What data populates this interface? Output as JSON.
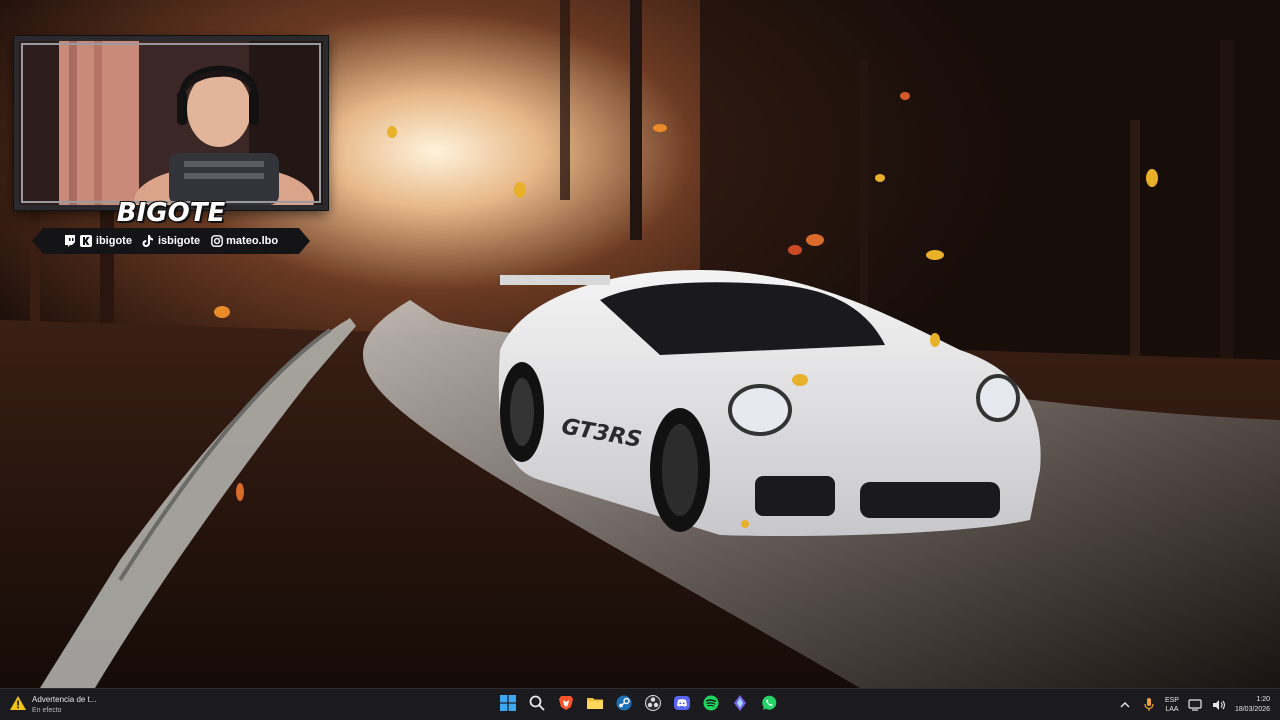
{
  "webcam": {
    "brand": "BIGOTE",
    "socials": [
      {
        "icon": "twitch-icon",
        "handle": "ibigote"
      },
      {
        "icon": "tiktok-icon",
        "handle": "isbigote"
      },
      {
        "icon": "instagram-icon",
        "handle": "mateo.lbo"
      }
    ]
  },
  "taskbar": {
    "notification": {
      "title": "Advertencia de t...",
      "subtitle": "En efecto",
      "icon": "warning-icon"
    },
    "apps": [
      {
        "name": "windows-start",
        "icon": "windows-icon"
      },
      {
        "name": "search",
        "icon": "search-icon"
      },
      {
        "name": "brave-browser",
        "icon": "brave-icon"
      },
      {
        "name": "file-explorer",
        "icon": "folder-icon"
      },
      {
        "name": "steam",
        "icon": "steam-icon"
      },
      {
        "name": "obs",
        "icon": "obs-icon"
      },
      {
        "name": "discord",
        "icon": "discord-icon"
      },
      {
        "name": "spotify",
        "icon": "spotify-icon"
      },
      {
        "name": "app-launcher",
        "icon": "diamond-app-icon"
      },
      {
        "name": "whatsapp",
        "icon": "whatsapp-icon"
      }
    ],
    "tray": {
      "language": "ESP",
      "layout": "LAA",
      "time": "1:20",
      "date": "18/03/2026"
    }
  },
  "colors": {
    "taskbar_bg": "#1b1b1f",
    "accent_warning": "#f2c21b",
    "spotify_green": "#1ed760",
    "discord_blurple": "#5865f2"
  }
}
